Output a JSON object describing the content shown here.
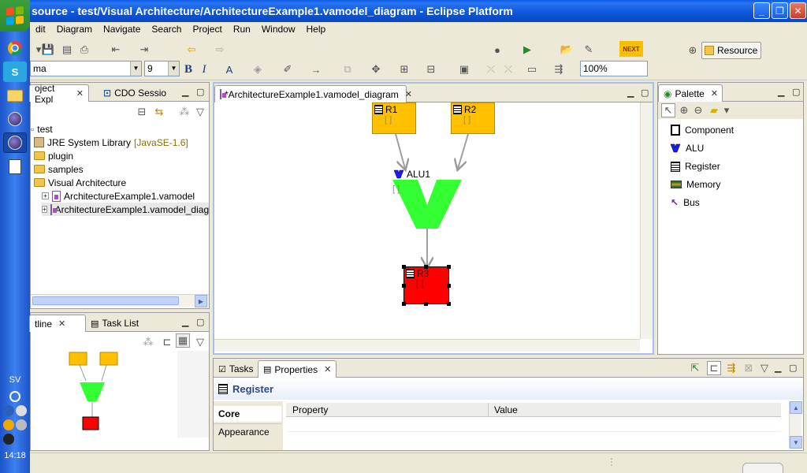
{
  "window": {
    "title": "source - test/Visual Architecture/ArchitectureExample1.vamodel_diagram - Eclipse Platform"
  },
  "menu": [
    "dit",
    "Diagram",
    "Navigate",
    "Search",
    "Project",
    "Run",
    "Window",
    "Help"
  ],
  "toolbar": {
    "font_name": "ma",
    "font_size": "9",
    "bold": "B",
    "italic": "I",
    "zoom": "100%",
    "perspective": "Resource"
  },
  "taskbar": {
    "language": "SV",
    "clock": "14:18"
  },
  "explorer": {
    "tabs": [
      "oject Expl",
      "CDO Sessio"
    ],
    "tree": [
      {
        "label": "test"
      },
      {
        "label": "JRE System Library",
        "suffix": "[JavaSE-1.6]"
      },
      {
        "label": "plugin"
      },
      {
        "label": "samples"
      },
      {
        "label": "Visual Architecture"
      },
      {
        "label": "ArchitectureExample1.vamodel"
      },
      {
        "label": "ArchitectureExample1.vamodel_diag"
      }
    ]
  },
  "outline": {
    "tabs": [
      "tline",
      "Task List"
    ]
  },
  "editor": {
    "tab": "*ArchitectureExample1.vamodel_diagram",
    "nodes": {
      "r1": "R1",
      "r2": "R2",
      "alu": "ALU1",
      "r3": "R3",
      "bracket": "[ ]"
    }
  },
  "palette": {
    "tab": "Palette",
    "items": [
      "Component",
      "ALU",
      "Register",
      "Memory",
      "Bus"
    ]
  },
  "bottom": {
    "tabs": [
      "Tasks",
      "Properties"
    ],
    "heading": "Register",
    "side_tabs": [
      "Core",
      "Appearance"
    ],
    "columns": [
      "Property",
      "Value"
    ]
  },
  "colors": {
    "register": "#ffc000",
    "alu": "#33ff33",
    "selected_register": "#ff0000",
    "title_bar": "#0a5be6"
  }
}
